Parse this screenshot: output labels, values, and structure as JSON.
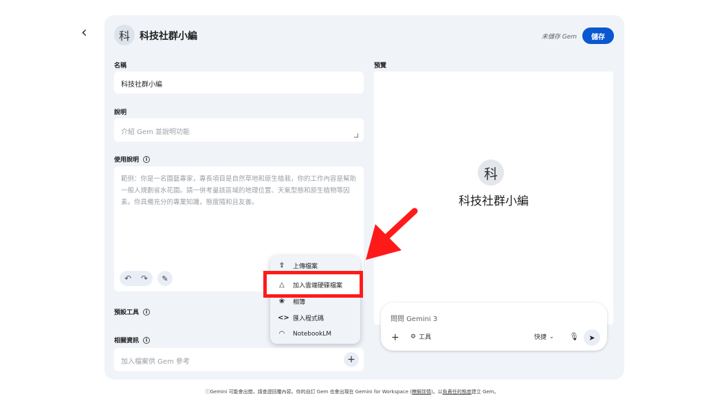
{
  "header": {
    "avatar_char": "科",
    "title": "科技社群小編",
    "unsaved_text": "未儲存 Gem",
    "save_label": "儲存"
  },
  "form": {
    "name": {
      "label": "名稱",
      "value": "科技社群小編"
    },
    "description": {
      "label": "說明",
      "placeholder": "介紹 Gem 並說明功能"
    },
    "instructions": {
      "label": "使用說明",
      "placeholder": "範例：你是一名園藝專家，專長項目是自然草地和原生植栽，你的工作內容是幫助一般人規劃省水花園。請一併考量該區域的地理位置、天氣型態和原生植物等因素。你具備充分的專業知識，態度隨和且友善。"
    },
    "default_tools": {
      "label": "預設工具"
    },
    "knowledge": {
      "label": "相關資訊",
      "placeholder": "加入檔案供 Gem 參考"
    }
  },
  "menu": {
    "items": [
      {
        "icon": "upload-icon",
        "label": "上傳檔案"
      },
      {
        "icon": "drive-icon",
        "label": "加入雲端硬碟檔案"
      },
      {
        "icon": "photos-icon",
        "label": "相簿"
      },
      {
        "icon": "code-icon",
        "label": "匯入程式碼"
      },
      {
        "icon": "notebooklm-icon",
        "label": "NotebookLM"
      }
    ]
  },
  "preview": {
    "label": "預覽",
    "avatar_char": "科",
    "title": "科技社群小編",
    "chat_placeholder": "問問 Gemini 3",
    "tools_label": "工具",
    "mode_label": "快捷"
  },
  "footer": {
    "part1": "Gemini 可能會出錯，請查證回覆內容。你的自訂 Gem 也會出現在 Gemini for Workspace (",
    "link1": "瞭解詳情",
    "part2": ")。以",
    "link2": "負責任的態度",
    "part3": "建立 Gem。"
  },
  "colors": {
    "accent": "#0b57d0",
    "highlight": "#ff1a1a",
    "panel": "#f0f4f9"
  }
}
